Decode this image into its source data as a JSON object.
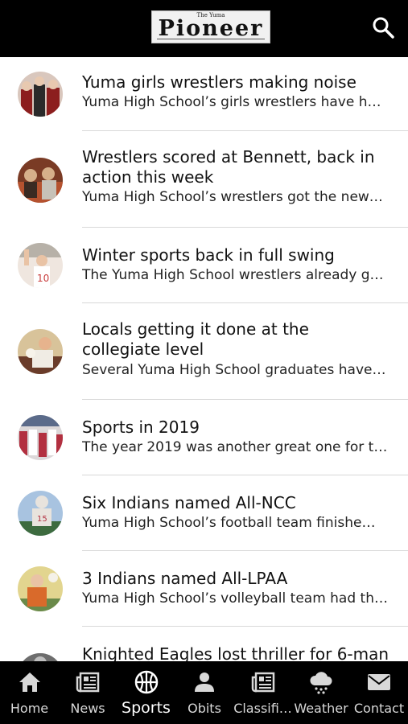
{
  "header": {
    "logo_small": "The Yuma",
    "logo_name": "Pioneer"
  },
  "articles": [
    {
      "title": "Yuma girls wrestlers making noise",
      "snippet": "Yuma High School’s girls wrestlers have h…",
      "thumb_colors": [
        "#d9c7bd",
        "#8c1e1e",
        "#2a2a2a"
      ]
    },
    {
      "title": "Wrestlers scored at Bennett, back in action this week",
      "snippet": "Yuma High School’s wrestlers got the new…",
      "thumb_colors": [
        "#b5522f",
        "#7a3b25",
        "#d6b08a"
      ]
    },
    {
      "title": "Winter sports back in full swing",
      "snippet": "The Yuma High School wrestlers already g…",
      "thumb_colors": [
        "#efe6df",
        "#c83a3a",
        "#b7b1a8"
      ]
    },
    {
      "title": "Locals getting it done at the collegiate level",
      "snippet": "Several Yuma High School graduates have…",
      "thumb_colors": [
        "#d8c39a",
        "#6a3c2a",
        "#f0ece4"
      ]
    },
    {
      "title": "Sports in 2019",
      "snippet": "The year 2019 was another great one for t…",
      "thumb_colors": [
        "#dcd8d9",
        "#b23040",
        "#5b6b8a"
      ]
    },
    {
      "title": "Six Indians named All-NCC",
      "snippet": "Yuma High School’s football team finishe…",
      "thumb_colors": [
        "#a8c3e0",
        "#e8e3dd",
        "#3d6b3f"
      ]
    },
    {
      "title": "3 Indians named All-LPAA",
      "snippet": "Yuma High School’s volleyball team had th…",
      "thumb_colors": [
        "#e2d58f",
        "#d96a2b",
        "#6a8a4a"
      ]
    },
    {
      "title": "Knighted Eagles lost thriller for 6-man",
      "snippet": "",
      "thumb_colors": [
        "#9a9a9a",
        "#6d6d6d",
        "#c0c0c0"
      ]
    }
  ],
  "tabs": [
    {
      "label": "Home",
      "icon": "home-icon"
    },
    {
      "label": "News",
      "icon": "newspaper-icon"
    },
    {
      "label": "Sports",
      "icon": "basketball-icon",
      "active": true
    },
    {
      "label": "Obits",
      "icon": "person-icon"
    },
    {
      "label": "Classifi…",
      "icon": "newspaper-icon"
    },
    {
      "label": "Weather",
      "icon": "weather-icon"
    },
    {
      "label": "Contact",
      "icon": "mail-icon"
    }
  ],
  "colors": {
    "bar": "#000000",
    "separator": "#d8d8d8",
    "tab_text": "#d8d8d8"
  }
}
